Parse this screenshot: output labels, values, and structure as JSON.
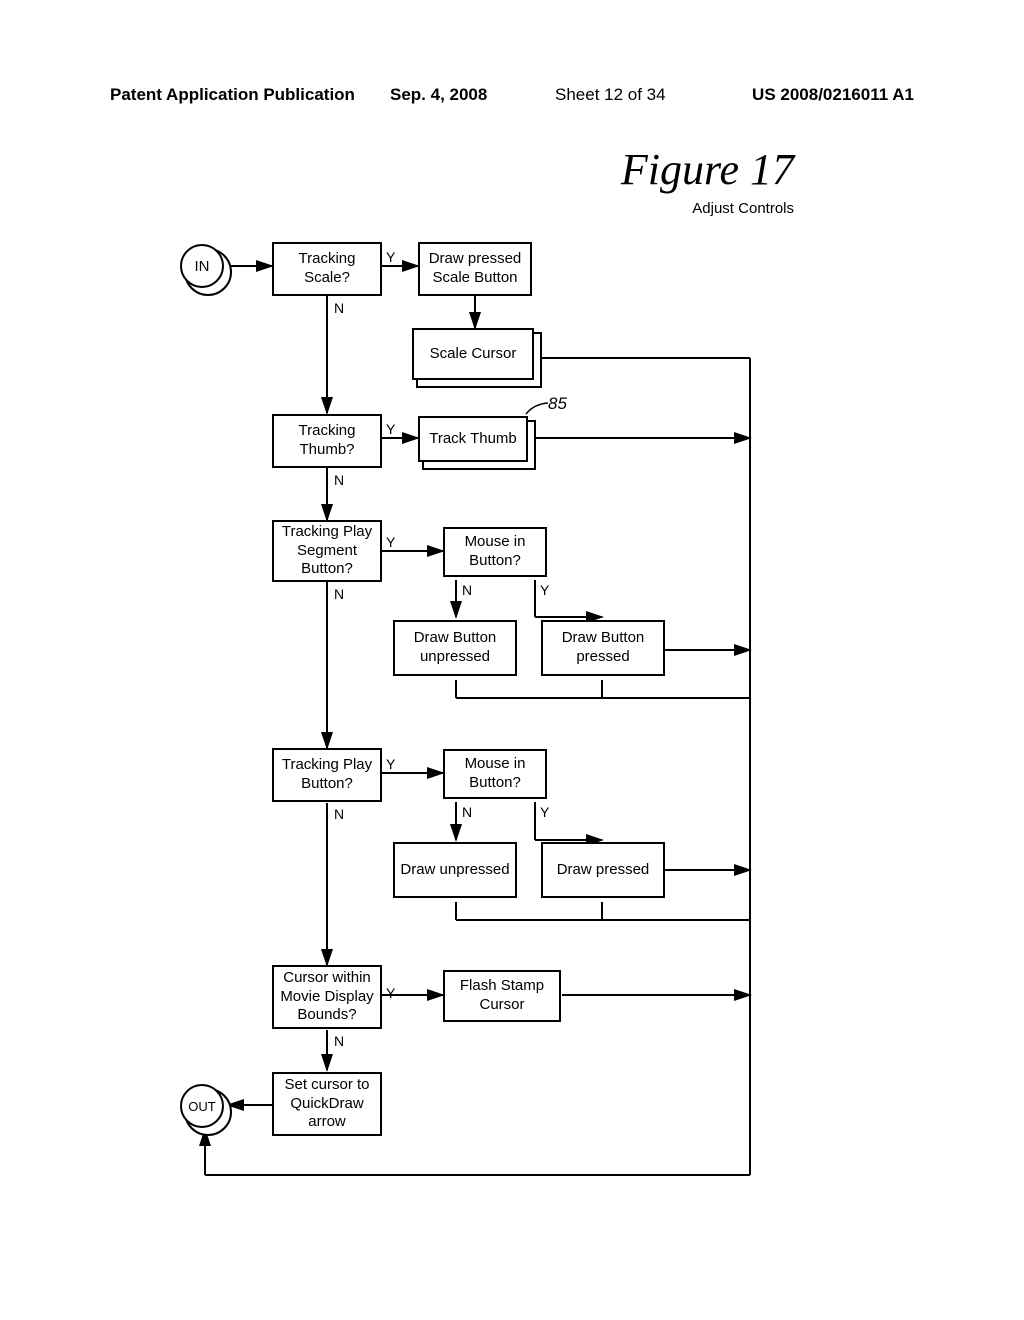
{
  "header": {
    "pub_label": "Patent Application Publication",
    "date": "Sep. 4, 2008",
    "sheet": "Sheet 12 of 34",
    "pubno": "US 2008/0216011 A1"
  },
  "figure": {
    "title": "Figure 17",
    "subtitle": "Adjust Controls"
  },
  "terms": {
    "in": "IN",
    "out": "OUT"
  },
  "boxes": {
    "tracking_scale": "Tracking Scale?",
    "draw_pressed_scale": "Draw pressed Scale Button",
    "scale_cursor": "Scale Cursor",
    "tracking_thumb": "Tracking Thumb?",
    "track_thumb": "Track Thumb",
    "tracking_play_seg": "Tracking Play Segment Button?",
    "mouse_in_button1": "Mouse in Button?",
    "draw_unpressed1": "Draw Button unpressed",
    "draw_pressed1": "Draw Button pressed",
    "tracking_play": "Tracking Play Button?",
    "mouse_in_button2": "Mouse in Button?",
    "draw_unpressed2": "Draw unpressed",
    "draw_pressed2": "Draw pressed",
    "cursor_within": "Cursor within Movie Display Bounds?",
    "flash_stamp": "Flash Stamp Cursor",
    "set_cursor": "Set cursor to QuickDraw arrow"
  },
  "labels": {
    "Y": "Y",
    "N": "N",
    "ref85": "85"
  }
}
